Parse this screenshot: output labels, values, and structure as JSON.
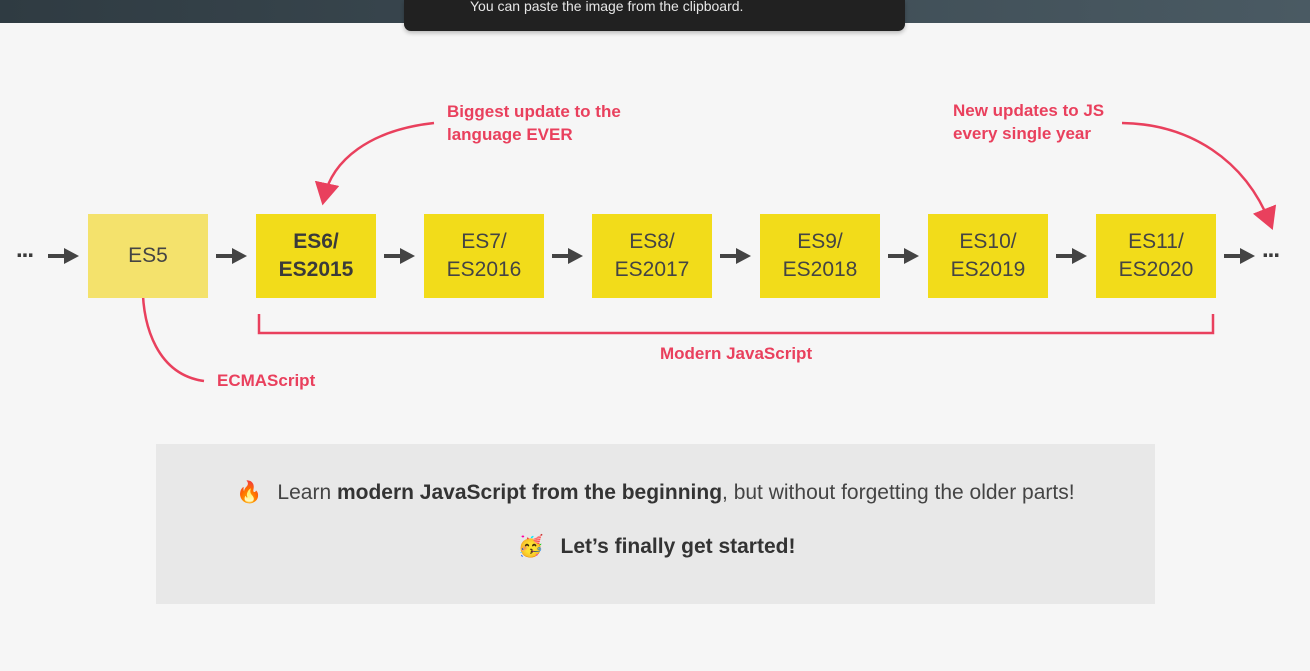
{
  "toast": {
    "text": "You can paste the image from the clipboard."
  },
  "timeline": {
    "leading_ellipsis": "...",
    "trailing_ellipsis": "...",
    "versions": [
      {
        "label": "ES5"
      },
      {
        "label": "ES6/\nES2015"
      },
      {
        "label": "ES7/\nES2016"
      },
      {
        "label": "ES8/\nES2017"
      },
      {
        "label": "ES9/\nES2018"
      },
      {
        "label": "ES10/\nES2019"
      },
      {
        "label": "ES11/\nES2020"
      }
    ]
  },
  "annotations": {
    "biggest_update": "Biggest update to the\nlanguage EVER",
    "new_updates": "New updates to JS\nevery single year",
    "ecmascript": "ECMAScript",
    "modern_js": "Modern JavaScript"
  },
  "colors": {
    "accent": "#e9405d",
    "es5_box": "#f4e26c",
    "modern_box": "#f2dc1a",
    "arrow": "#444444"
  },
  "bottom": {
    "line1_emoji": "🔥",
    "line1_prefix": "Learn ",
    "line1_bold": "modern JavaScript from the beginning",
    "line1_suffix": ", but without forgetting the older parts!",
    "line2_emoji": "🥳",
    "line2_text": "Let’s finally get started!"
  }
}
